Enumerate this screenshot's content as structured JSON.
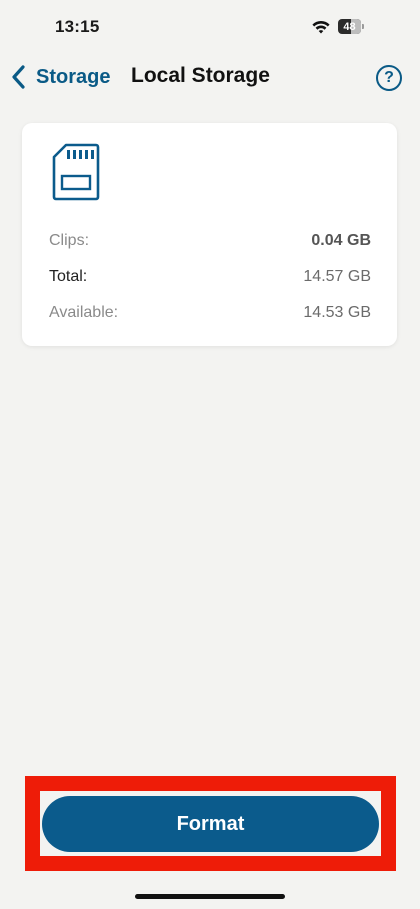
{
  "status_bar": {
    "time": "13:15",
    "battery": "48",
    "wifi_icon": "wifi-icon",
    "battery_icon": "battery-icon"
  },
  "nav": {
    "back_label": "Storage",
    "title": "Local Storage",
    "help_label": "?",
    "back_icon": "chevron-left-icon",
    "help_icon": "help-circle-icon"
  },
  "card": {
    "icon": "sd-card-icon",
    "rows": [
      {
        "label": "Clips:",
        "value": "0.04 GB"
      },
      {
        "label": "Total:",
        "value": "14.57 GB"
      },
      {
        "label": "Available:",
        "value": "14.53 GB"
      }
    ]
  },
  "actions": {
    "format_label": "Format"
  },
  "colors": {
    "accent": "#0b5b8c",
    "background": "#f3f3f1",
    "highlight": "#ee1c08"
  }
}
